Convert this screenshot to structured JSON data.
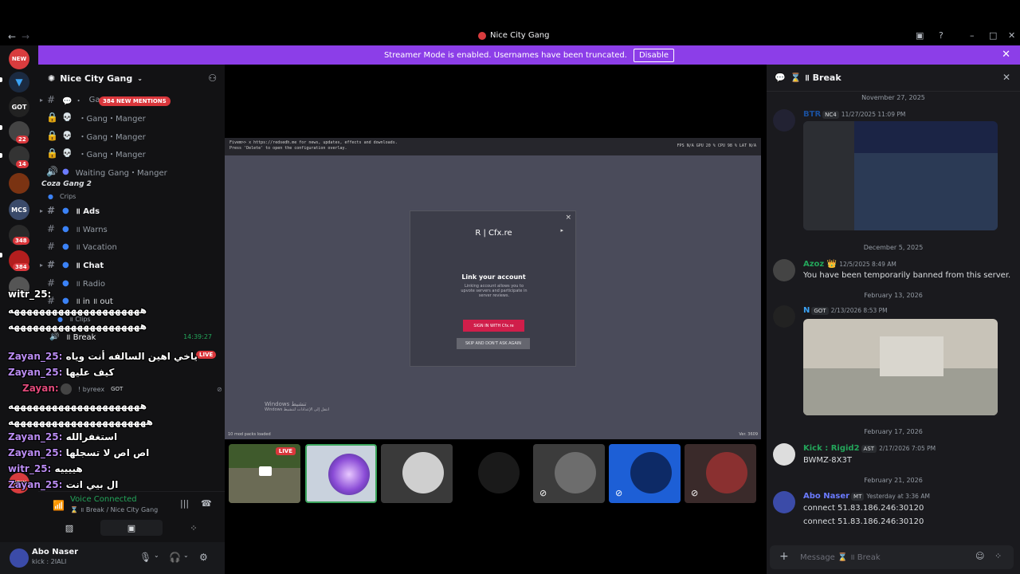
{
  "window": {
    "title": "Nice City Gang",
    "back": "←",
    "forward": "→"
  },
  "banner": {
    "text": "Streamer Mode is enabled. Usernames have been truncated.",
    "button": "Disable"
  },
  "rail": {
    "new_badge": "NEW",
    "new_badge_bottom": "NEW",
    "badges": [
      "22",
      "14",
      "348",
      "384"
    ]
  },
  "sidebar": {
    "server_name": "Nice City Gang",
    "mentions_badge": "384 NEW MENTIONS",
    "channels": [
      {
        "name": "Gang",
        "prefix": "💬 ・"
      },
      {
        "name": "・Gang・Manger"
      },
      {
        "name": "・Gang・Manger"
      },
      {
        "name": "・Gang・Manger"
      },
      {
        "name": "Waiting Gang・Manger"
      },
      {
        "name": "Coza Gang 2"
      },
      {
        "name": "Crips"
      },
      {
        "name": "॥ Ads"
      },
      {
        "name": "॥ Warns"
      },
      {
        "name": "॥ Vacation"
      },
      {
        "name": "॥ Chat"
      },
      {
        "name": "॥ Radio"
      },
      {
        "name": "॥ in ॥ out"
      },
      {
        "name": "॥ Clips"
      },
      {
        "name": "॥ Break"
      }
    ],
    "voice_time": "14:39:27",
    "member": "! byreex",
    "member_tag": "GOT",
    "live": "LIVE"
  },
  "overlay_chat": [
    {
      "user": "witr_25:",
      "text": ""
    },
    {
      "user": "",
      "text": "هههههههههههههههههههههه"
    },
    {
      "user": "",
      "text": "هههههههههههههههههههههه"
    },
    {
      "user": "Zayan_25:",
      "text": "ياخي اهين السالفه أنت وياه"
    },
    {
      "user": "Zayan_25:",
      "text": "كيف عليها"
    },
    {
      "user": "Zayan:",
      "text": ""
    },
    {
      "user": "",
      "text": "هههههههههههههههههههههه"
    },
    {
      "user": "",
      "text": "ههههههههههههههههههههههه"
    },
    {
      "user": "Zayan_25:",
      "text": "استغفرالله"
    },
    {
      "user": "Zayan_25:",
      "text": "اص اص لا تسجلها"
    },
    {
      "user": "witr_25:",
      "text": "هييييه"
    },
    {
      "user": "Zayan_25:",
      "text": "ال بيي انت"
    }
  ],
  "voice_panel": {
    "status": "Voice Connected",
    "channel": "⌛ ॥ Break / Nice City Gang"
  },
  "user": {
    "name": "Abo Naser",
    "status": "kick : 2IALI"
  },
  "game": {
    "console_line1": "Fivem>> x https://redsedh.me for news, updates, effects and downloads.",
    "console_line2": "Press 'Delete' to open the configuration overlay.",
    "fps": "FPS N/A   GPU 20 %   CPU 98 %   LAT N/A",
    "loaded": "10 mod packs loaded",
    "version": "Ver. 3609",
    "windows_line1": "Windows تنشيط",
    "windows_line2": "Windows انتقل إلى الإعدادات لتنشيط"
  },
  "cfx_modal": {
    "brand": "R  |  Cfx.re",
    "heading": "Link your account",
    "desc": "Linking account allows you to upvote servers and participate in server reviews.",
    "sign_in": "SIGN IN WITH Cfx.re",
    "skip": "SKIP AND DON'T ASK AGAIN",
    "close": "×"
  },
  "tiles": {
    "live": "LIVE"
  },
  "thread": {
    "title": "⌛ ॥ Break",
    "messages": [
      {
        "date": "November 27, 2025",
        "user": "BTR",
        "tag": "NC4",
        "time": "11/27/2025 11:09 PM",
        "text": ""
      },
      {
        "date": "December 5, 2025",
        "user": "Azoz 👑",
        "tag": "",
        "time": "12/5/2025 8:49 AM",
        "text": "You have been temporarily banned from this server."
      },
      {
        "date": "February 13, 2026",
        "user": "N",
        "tag": "GOT",
        "time": "2/13/2026 8:53 PM",
        "text": ""
      },
      {
        "date": "February 17, 2026",
        "user": "Kick : Rigid2",
        "tag": "AST",
        "time": "2/17/2026 7:05 PM",
        "text": "BWMZ-8X3T"
      },
      {
        "date": "February 21, 2026",
        "user": "Abo Naser",
        "tag": "MT",
        "time": "Yesterday at 3:36 AM",
        "text": "connect 51.83.186.246:30120",
        "text2": "connect 51.83.186.246:30120"
      }
    ],
    "composer_placeholder": "Message ⌛ ॥ Break"
  },
  "colors": {
    "banner": "#8c3ee8",
    "voice_green": "#23a55a",
    "badge_red": "#da373c"
  }
}
